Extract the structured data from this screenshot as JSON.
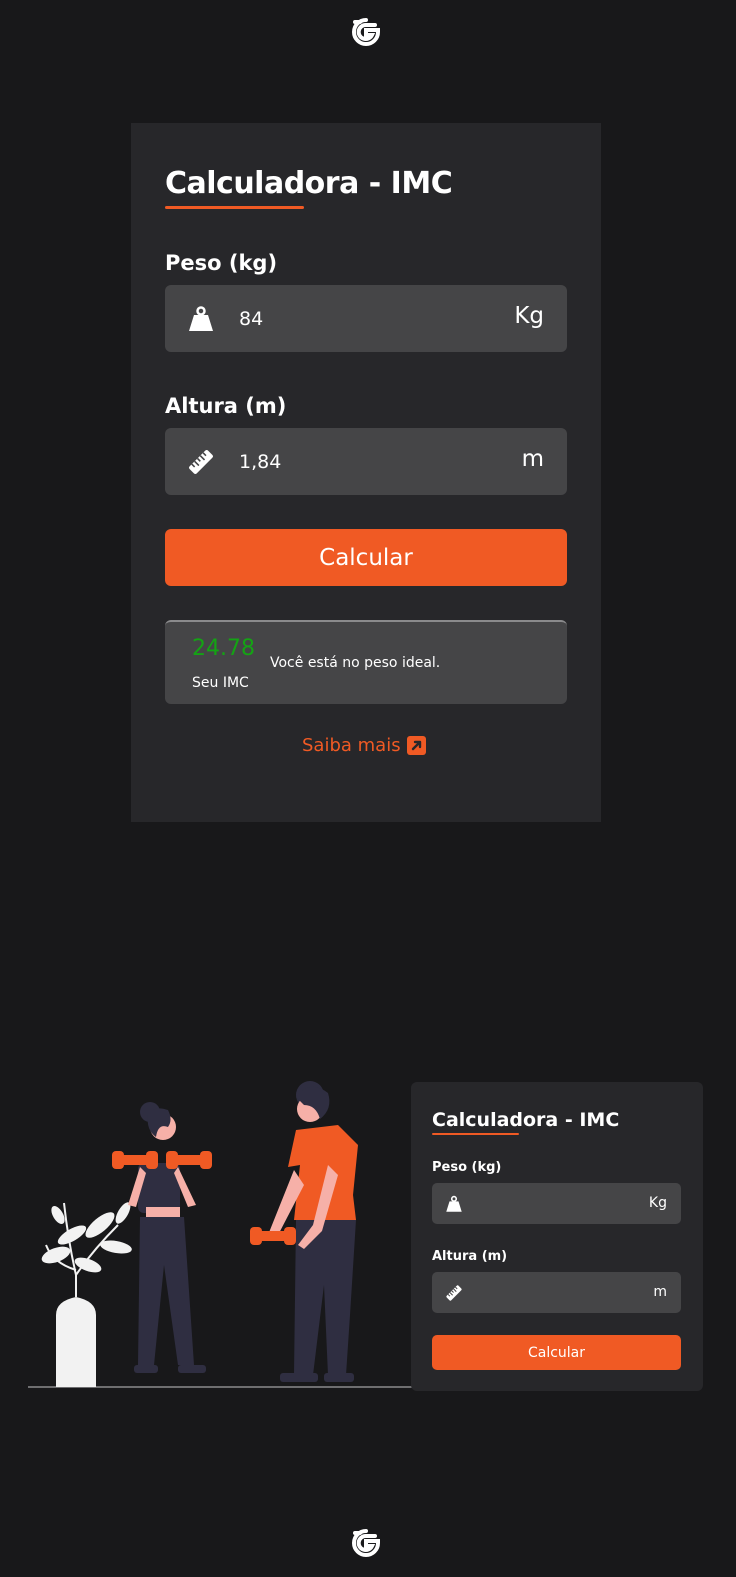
{
  "icons": {
    "logo": "g-logo-icon",
    "weight": "weight-icon",
    "height": "ruler-icon",
    "external": "external-link-icon"
  },
  "colors": {
    "background": "#18181a",
    "card": "#27272a",
    "field": "#454547",
    "accent": "#f05a24",
    "success": "#14a314"
  },
  "calculator": {
    "title": "Calculadora - IMC",
    "weight": {
      "label": "Peso (kg)",
      "value": "84",
      "unit": "Kg"
    },
    "height": {
      "label": "Altura (m)",
      "value": "1,84",
      "unit": "m"
    },
    "button_label": "Calcular",
    "result": {
      "value": "24.78",
      "label": "Seu IMC",
      "message": "Você está no peso ideal."
    },
    "more_link": "Saiba mais"
  },
  "preview": {
    "title": "Calculadora - IMC",
    "weight_label": "Peso (kg)",
    "weight_unit": "Kg",
    "height_label": "Altura (m)",
    "height_unit": "m",
    "button_label": "Calcular"
  }
}
